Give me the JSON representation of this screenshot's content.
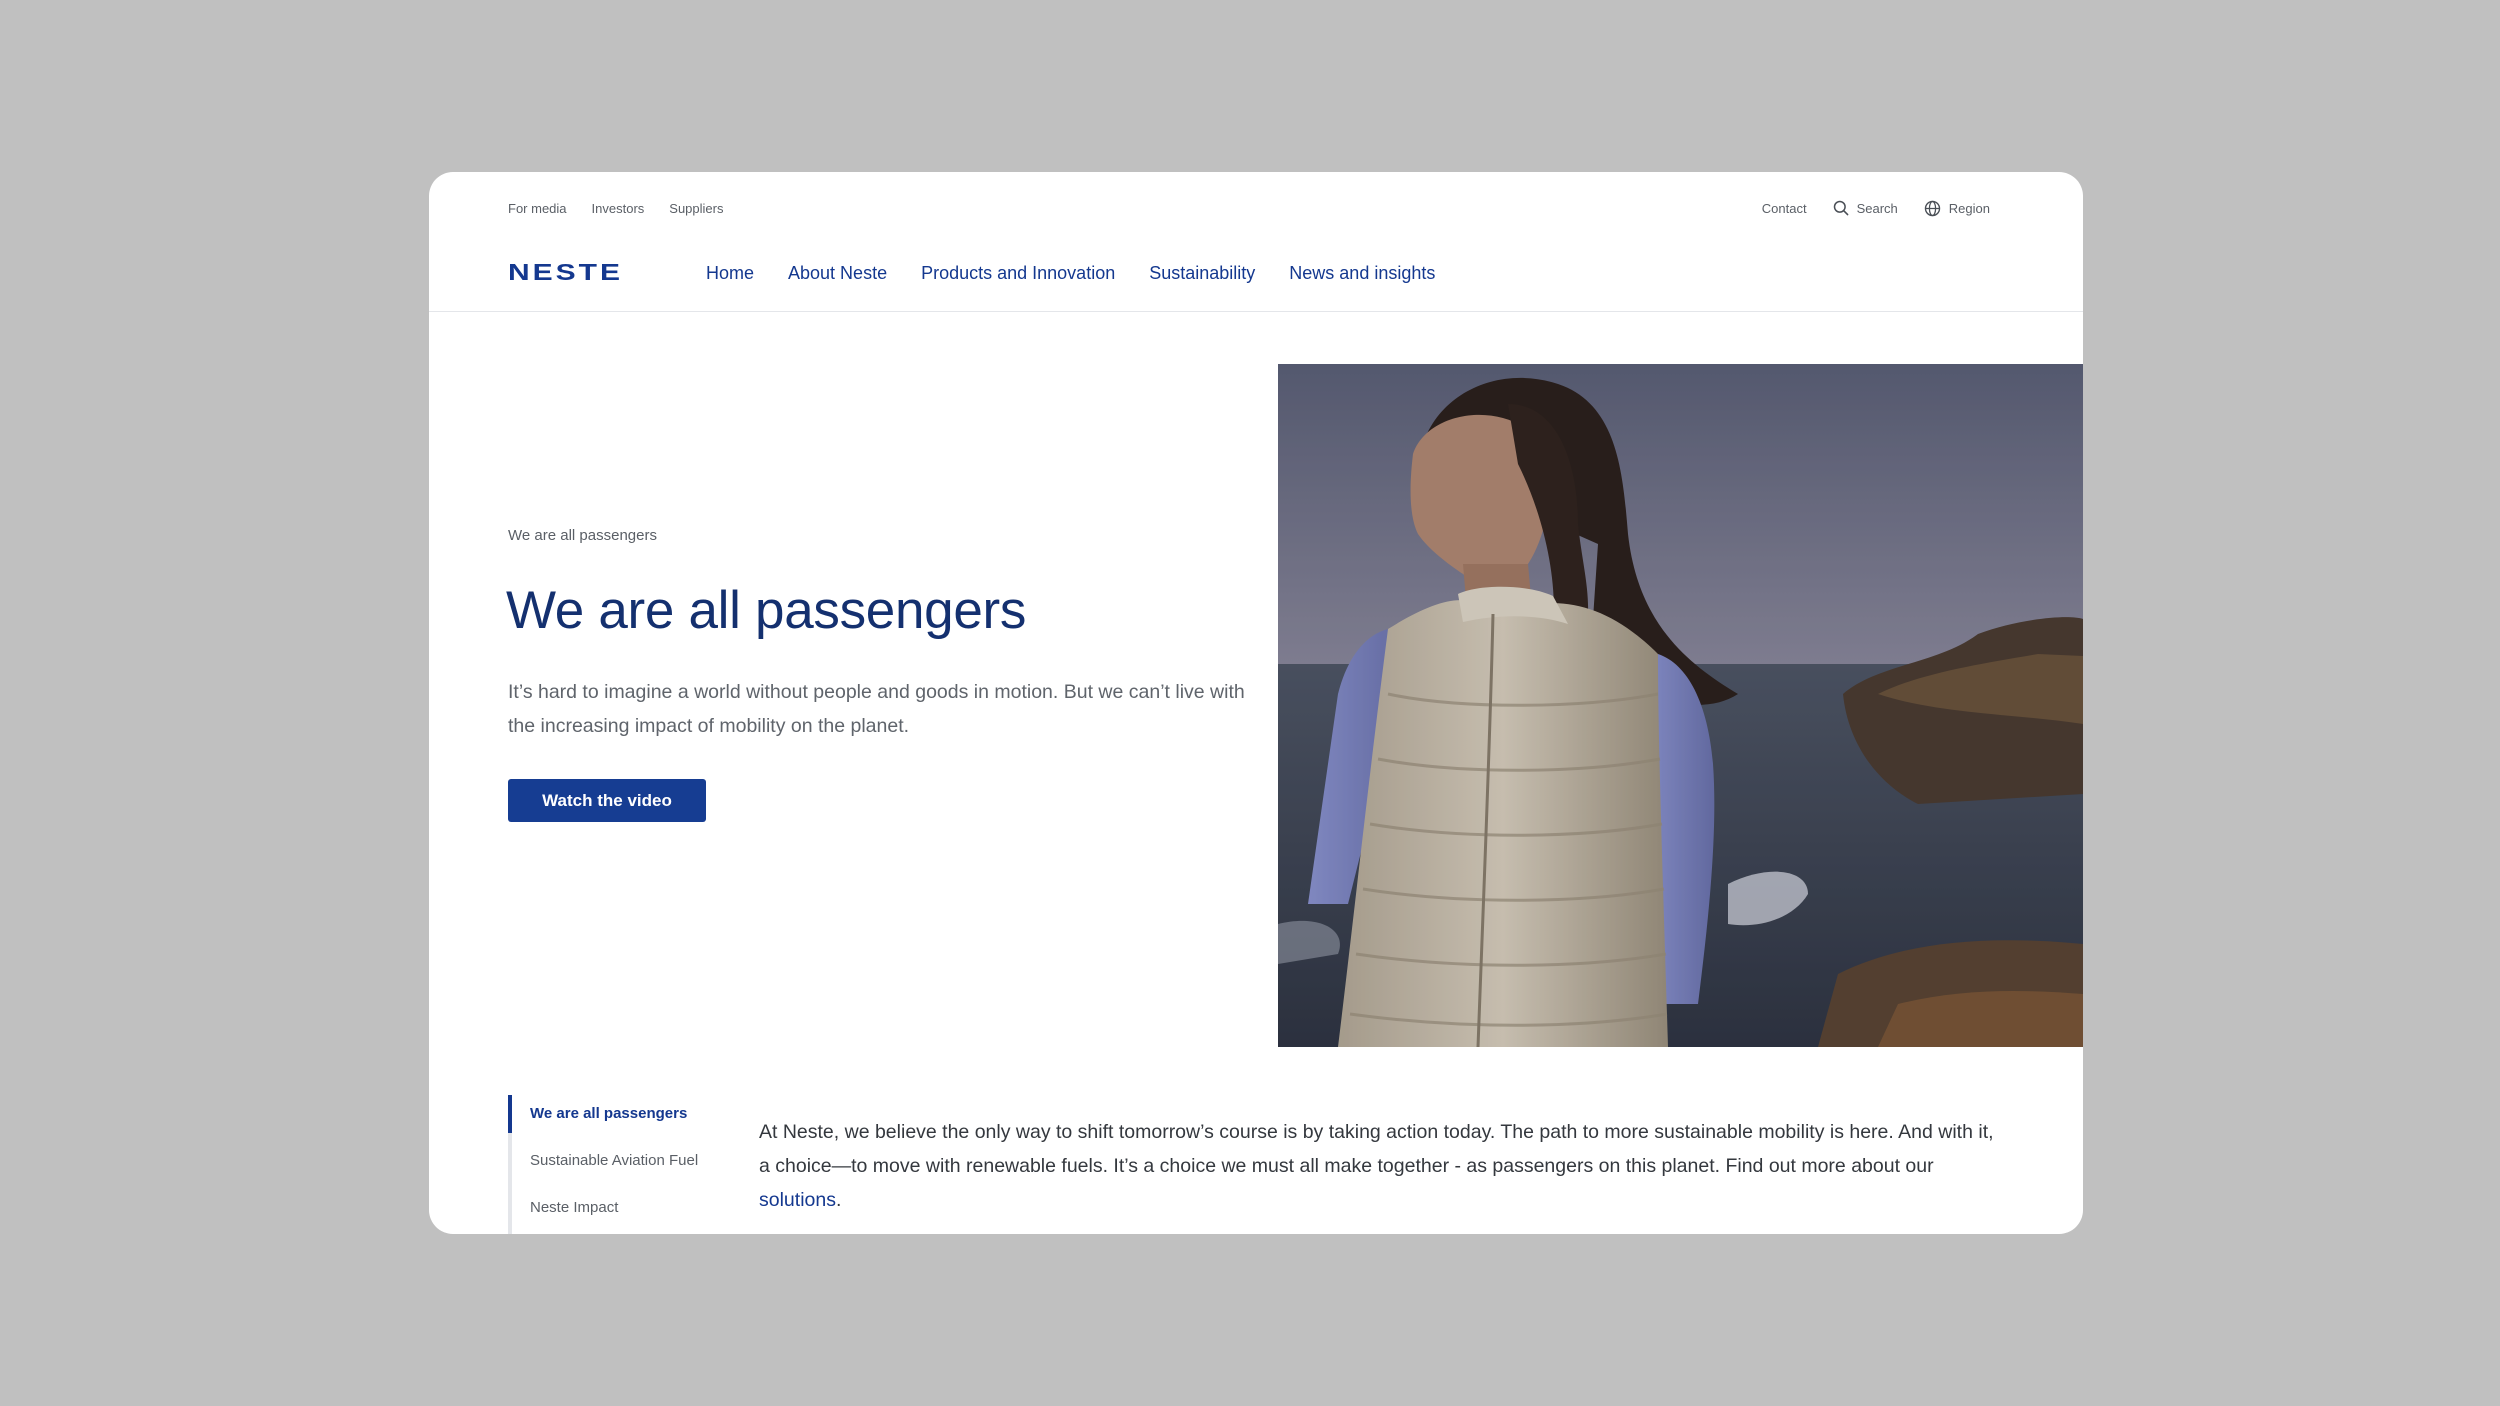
{
  "utility_nav": {
    "left": [
      "For media",
      "Investors",
      "Suppliers"
    ],
    "contact": "Contact",
    "search": "Search",
    "region": "Region"
  },
  "logo": "NESTE",
  "main_nav": [
    "Home",
    "About Neste",
    "Products and Innovation",
    "Sustainability",
    "News and insights"
  ],
  "hero": {
    "kicker": "We are all passengers",
    "title": "We are all passengers",
    "description": "It’s hard to imagine a world without people and goods in motion. But we can’t live with the increasing impact of mobility on the planet.",
    "cta": "Watch the video"
  },
  "section_nav": [
    "We are all passengers",
    "Sustainable Aviation Fuel",
    "Neste Impact"
  ],
  "body": {
    "text": "At Neste, we believe the only way to shift tomorrow’s course is by taking action today. The path to more sustainable mobility is here. And with it, a choice—to move with renewable fuels. It’s a choice we must all make together - as passengers on this planet. Find out more about our",
    "link": "solutions",
    "end": "."
  },
  "colors": {
    "brand_blue": "#14388f",
    "button_blue": "#163d92",
    "page_background": "#c0c0c0"
  }
}
